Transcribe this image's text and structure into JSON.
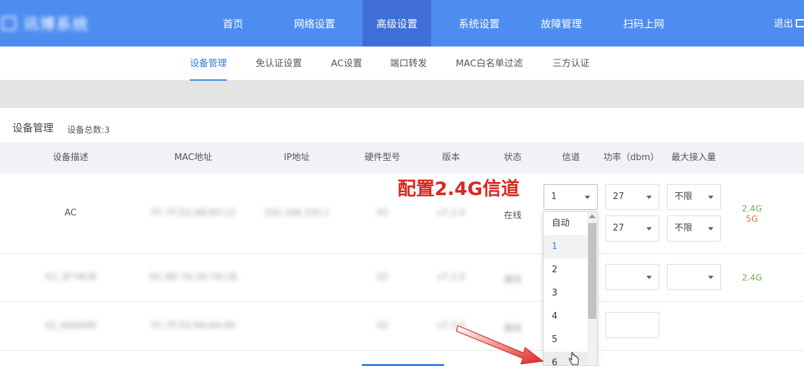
{
  "nav": {
    "logo_text": "讯博系统",
    "items": [
      "首页",
      "网络设置",
      "高级设置",
      "系统设置",
      "故障管理",
      "扫码上网"
    ],
    "active_index": 2,
    "logout": "退出"
  },
  "subnav": {
    "items": [
      "设备管理",
      "免认证设置",
      "AC设置",
      "端口转发",
      "MAC白名单过滤",
      "三方认证"
    ],
    "active_index": 0
  },
  "section": {
    "title": "设备管理",
    "count_label": "设备总数:3"
  },
  "table": {
    "headers": [
      "设备描述",
      "MAC地址",
      "IP地址",
      "硬件型号",
      "版本",
      "状态",
      "信道",
      "功率（dbm）",
      "最大接入量"
    ],
    "rows": [
      {
        "desc": "AC",
        "mac": "FC:7F:D2:AB:83:12",
        "ip": "192.168.150.1",
        "model": "X2",
        "version": "v7.2.0",
        "status": "在线",
        "channel_24": "1",
        "power_24": "27",
        "max_24": "不限",
        "power_5": "27",
        "max_5": "不限",
        "band_24": "2.4G",
        "band_5": "5G"
      },
      {
        "desc": "X2_3F7ACB",
        "mac": "DC:BE:7A:3A:7A:CB",
        "ip": "",
        "model": "X2",
        "version": "v7.2.0",
        "status": "离线",
        "band_24": "2.4G"
      },
      {
        "desc": "X2_6AAA90",
        "mac": "FC:7F:D2:6A:AA:90",
        "ip": "",
        "model": "X2",
        "version": "v7.2.0",
        "status": "离线"
      }
    ]
  },
  "dropdown": {
    "options": [
      "自动",
      "1",
      "2",
      "3",
      "4",
      "5",
      "6"
    ],
    "selected": "1",
    "hovered": "6"
  },
  "annotation": "配置2.4G信道",
  "colors": {
    "nav_bg": "#4e8df0",
    "nav_active": "#3f6fd6",
    "accent": "#3b86e6",
    "annotation": "#d9281f"
  }
}
